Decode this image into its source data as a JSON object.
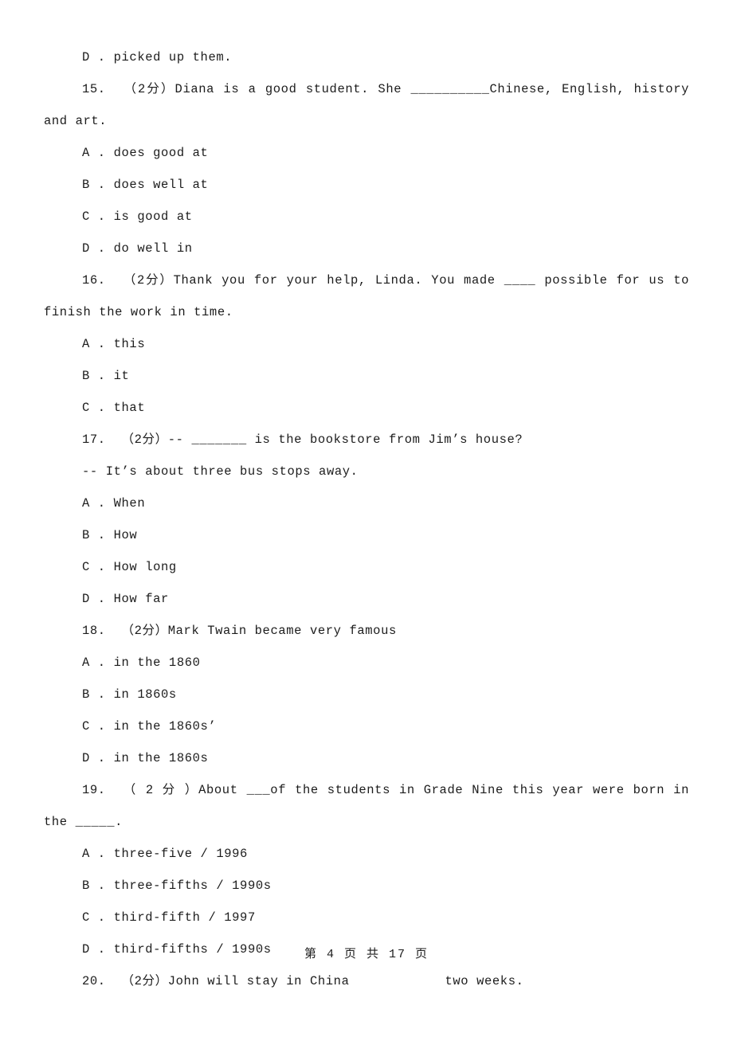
{
  "document": {
    "type": "exam-paper",
    "language": "en-zh",
    "points_marker": "（2分）",
    "footer": "第 4 页 共 17 页"
  },
  "body": {
    "orphan_option": {
      "key": "D .",
      "text": "picked up them."
    },
    "questions": [
      {
        "number": "15.",
        "points": "（2分）",
        "stem": "Diana is a good student. She __________Chinese, English, history and art.",
        "wraps": false,
        "options": [
          {
            "key": "A .",
            "text": "does good at"
          },
          {
            "key": "B .",
            "text": "does well at"
          },
          {
            "key": "C .",
            "text": "is good at"
          },
          {
            "key": "D .",
            "text": "do well in"
          }
        ]
      },
      {
        "number": "16.",
        "points": "（2分）",
        "stem": "Thank you for your help, Linda. You made ____ possible for us to finish the work in time.",
        "wraps": true,
        "options": [
          {
            "key": "A .",
            "text": "this"
          },
          {
            "key": "B .",
            "text": "it"
          },
          {
            "key": "C .",
            "text": "that"
          }
        ]
      },
      {
        "number": "17.",
        "points": "（2分）",
        "stem": "-- _______ is the bookstore from Jim’s house?",
        "continuation": "-- It’s about three bus stops away.",
        "wraps": false,
        "options": [
          {
            "key": "A .",
            "text": "When"
          },
          {
            "key": "B .",
            "text": "How"
          },
          {
            "key": "C .",
            "text": "How long"
          },
          {
            "key": "D .",
            "text": "How far"
          }
        ]
      },
      {
        "number": "18.",
        "points": "（2分）",
        "stem": "Mark Twain became very famous",
        "wraps": false,
        "options": [
          {
            "key": "A .",
            "text": "in the 1860"
          },
          {
            "key": "B .",
            "text": "in 1860s"
          },
          {
            "key": "C .",
            "text": "in the 1860s’"
          },
          {
            "key": "D .",
            "text": "in the 1860s"
          }
        ]
      },
      {
        "number": "19.",
        "points": "（ 2 分 ）",
        "stem": "About ___of the students in Grade Nine this year were born in the _____.",
        "wraps": true,
        "options": [
          {
            "key": "A .",
            "text": "three-five / 1996"
          },
          {
            "key": "B .",
            "text": "three-fifths / 1990s"
          },
          {
            "key": "C .",
            "text": "third-fifth / 1997"
          },
          {
            "key": "D .",
            "text": "third-fifths / 1990s"
          }
        ]
      },
      {
        "number": "20.",
        "points": "（2分）",
        "stem_before_gap": "John will stay in China",
        "stem_after_gap": "two weeks.",
        "wraps": false,
        "options": []
      }
    ]
  }
}
